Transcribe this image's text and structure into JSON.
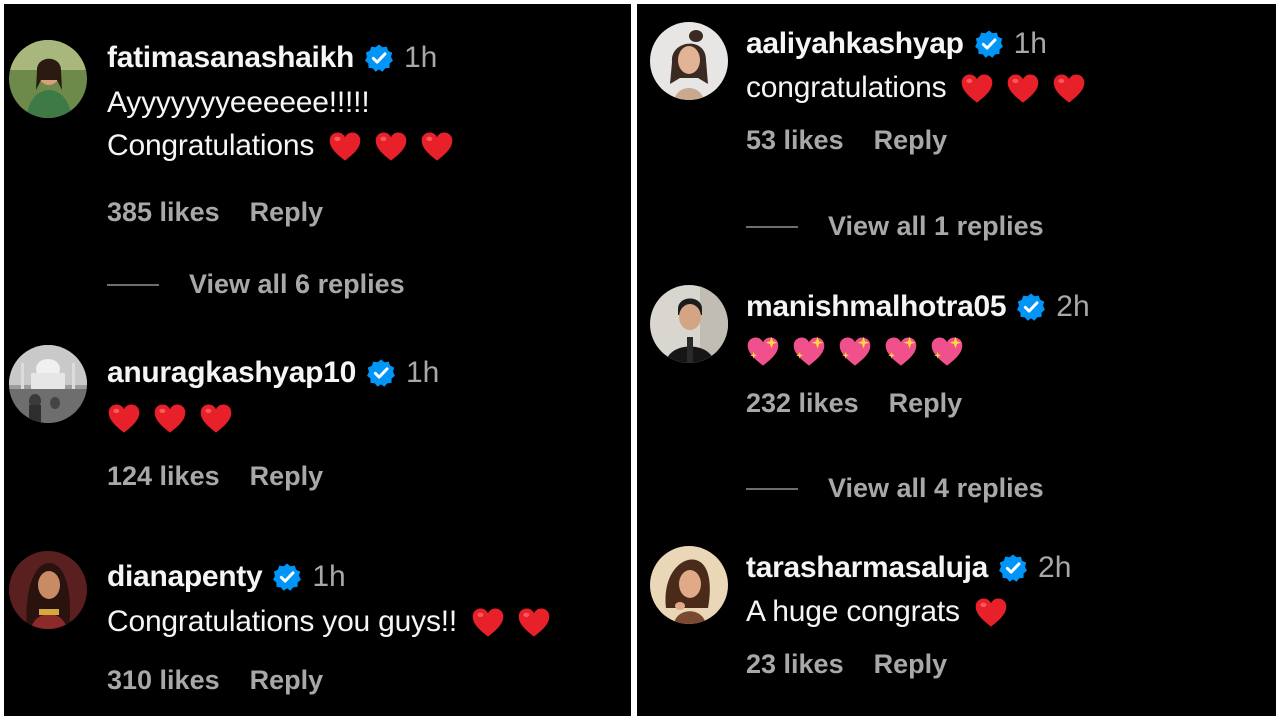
{
  "left_column": {
    "comments": [
      {
        "username": "fatimasanashaikh",
        "time": "1h",
        "text_line1": "Ayyyyyyyeeeeee!!!!!",
        "text_line2": "Congratulations",
        "emoji": "red-heart",
        "emoji_count": 3,
        "likes": "385 likes",
        "reply": "Reply",
        "view_replies": "View all 6 replies"
      },
      {
        "username": "anuragkashyap10",
        "time": "1h",
        "text_line1": "",
        "emoji": "red-heart",
        "emoji_count": 3,
        "likes": "124 likes",
        "reply": "Reply"
      },
      {
        "username": "dianapenty",
        "time": "1h",
        "text_line1": "Congratulations you guys!!",
        "emoji": "red-heart",
        "emoji_count": 2,
        "likes": "310 likes",
        "reply": "Reply"
      }
    ]
  },
  "right_column": {
    "comments": [
      {
        "username": "aaliyahkashyap",
        "time": "1h",
        "text_line1": "congratulations",
        "emoji": "red-heart",
        "emoji_count": 3,
        "likes": "53 likes",
        "reply": "Reply",
        "view_replies": "View all 1 replies"
      },
      {
        "username": "manishmalhotra05",
        "time": "2h",
        "text_line1": "",
        "emoji": "sparkling-heart",
        "emoji_count": 5,
        "likes": "232 likes",
        "reply": "Reply",
        "view_replies": "View all 4 replies"
      },
      {
        "username": "tarasharmasaluja",
        "time": "2h",
        "text_line1": "A huge congrats",
        "emoji": "red-heart",
        "emoji_count": 1,
        "likes": "23 likes",
        "reply": "Reply"
      }
    ]
  },
  "colors": {
    "background": "#000000",
    "text_primary": "#f5f5f5",
    "text_secondary": "#a8a8a8",
    "verified_blue": "#0095f6",
    "heart_red": "#e8202a",
    "sparkle_heart_pink": "#f0508c"
  }
}
